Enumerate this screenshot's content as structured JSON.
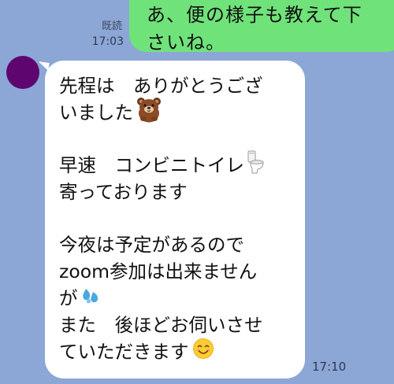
{
  "sent_message": {
    "lines": [
      "あ、便の様子も教えて下",
      "さいね。"
    ],
    "read_status": "既読",
    "time": "17:03"
  },
  "received_message": {
    "lines": [
      "先程は　ありがとうござ",
      "いました",
      "",
      "早速　コンビニトイレ",
      "寄っております",
      "",
      "今夜は予定があるので",
      "zoom参加は出来ません",
      "が",
      "また　後ほどお伺いさせ",
      "ていただきます"
    ],
    "time": "17:10"
  },
  "colors": {
    "background": "#8ca6d6",
    "sent_bubble": "#6fe37a",
    "received_bubble": "#ffffff",
    "avatar": "#5e056f"
  },
  "icons": {
    "line_2": "bear-sticker-icon",
    "line_4": "toilet-icon",
    "line_9": "sweat-droplets-icon",
    "line_11": "smiling-face-icon"
  }
}
